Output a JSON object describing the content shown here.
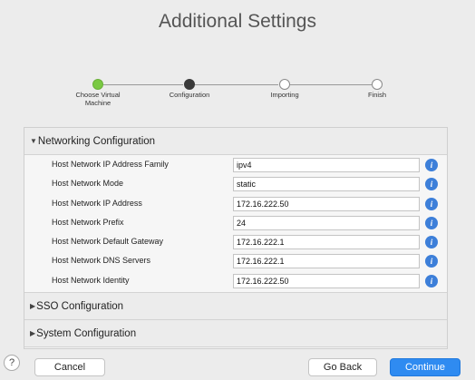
{
  "title": "Additional Settings",
  "stepper": {
    "steps": [
      {
        "label_line1": "Choose Virtual",
        "label_line2": "Machine",
        "state": "done"
      },
      {
        "label_line1": "Configuration",
        "label_line2": "",
        "state": "current"
      },
      {
        "label_line1": "Importing",
        "label_line2": "",
        "state": "pending"
      },
      {
        "label_line1": "Finish",
        "label_line2": "",
        "state": "pending"
      }
    ]
  },
  "sections": {
    "networking": {
      "label": "Networking Configuration",
      "expanded": true,
      "rows": [
        {
          "label": "Host Network IP Address Family",
          "value": "ipv4"
        },
        {
          "label": "Host Network Mode",
          "value": "static"
        },
        {
          "label": "Host Network IP Address",
          "value": "172.16.222.50"
        },
        {
          "label": "Host Network Prefix",
          "value": "24"
        },
        {
          "label": "Host Network Default Gateway",
          "value": "172.16.222.1"
        },
        {
          "label": "Host Network DNS Servers",
          "value": "172.16.222.1"
        },
        {
          "label": "Host Network Identity",
          "value": "172.16.222.50"
        }
      ]
    },
    "sso": {
      "label": "SSO Configuration",
      "expanded": false
    },
    "system": {
      "label": "System Configuration",
      "expanded": false
    }
  },
  "icons": {
    "expanded": "triangle-down-icon",
    "collapsed": "triangle-right-icon",
    "info": "info-icon"
  },
  "info_glyph": "i",
  "footer": {
    "help": "?",
    "cancel": "Cancel",
    "back": "Go Back",
    "continue": "Continue"
  },
  "colors": {
    "step_done": "#7ac943",
    "accent": "#2f8bf1",
    "info": "#3d7fd9"
  }
}
